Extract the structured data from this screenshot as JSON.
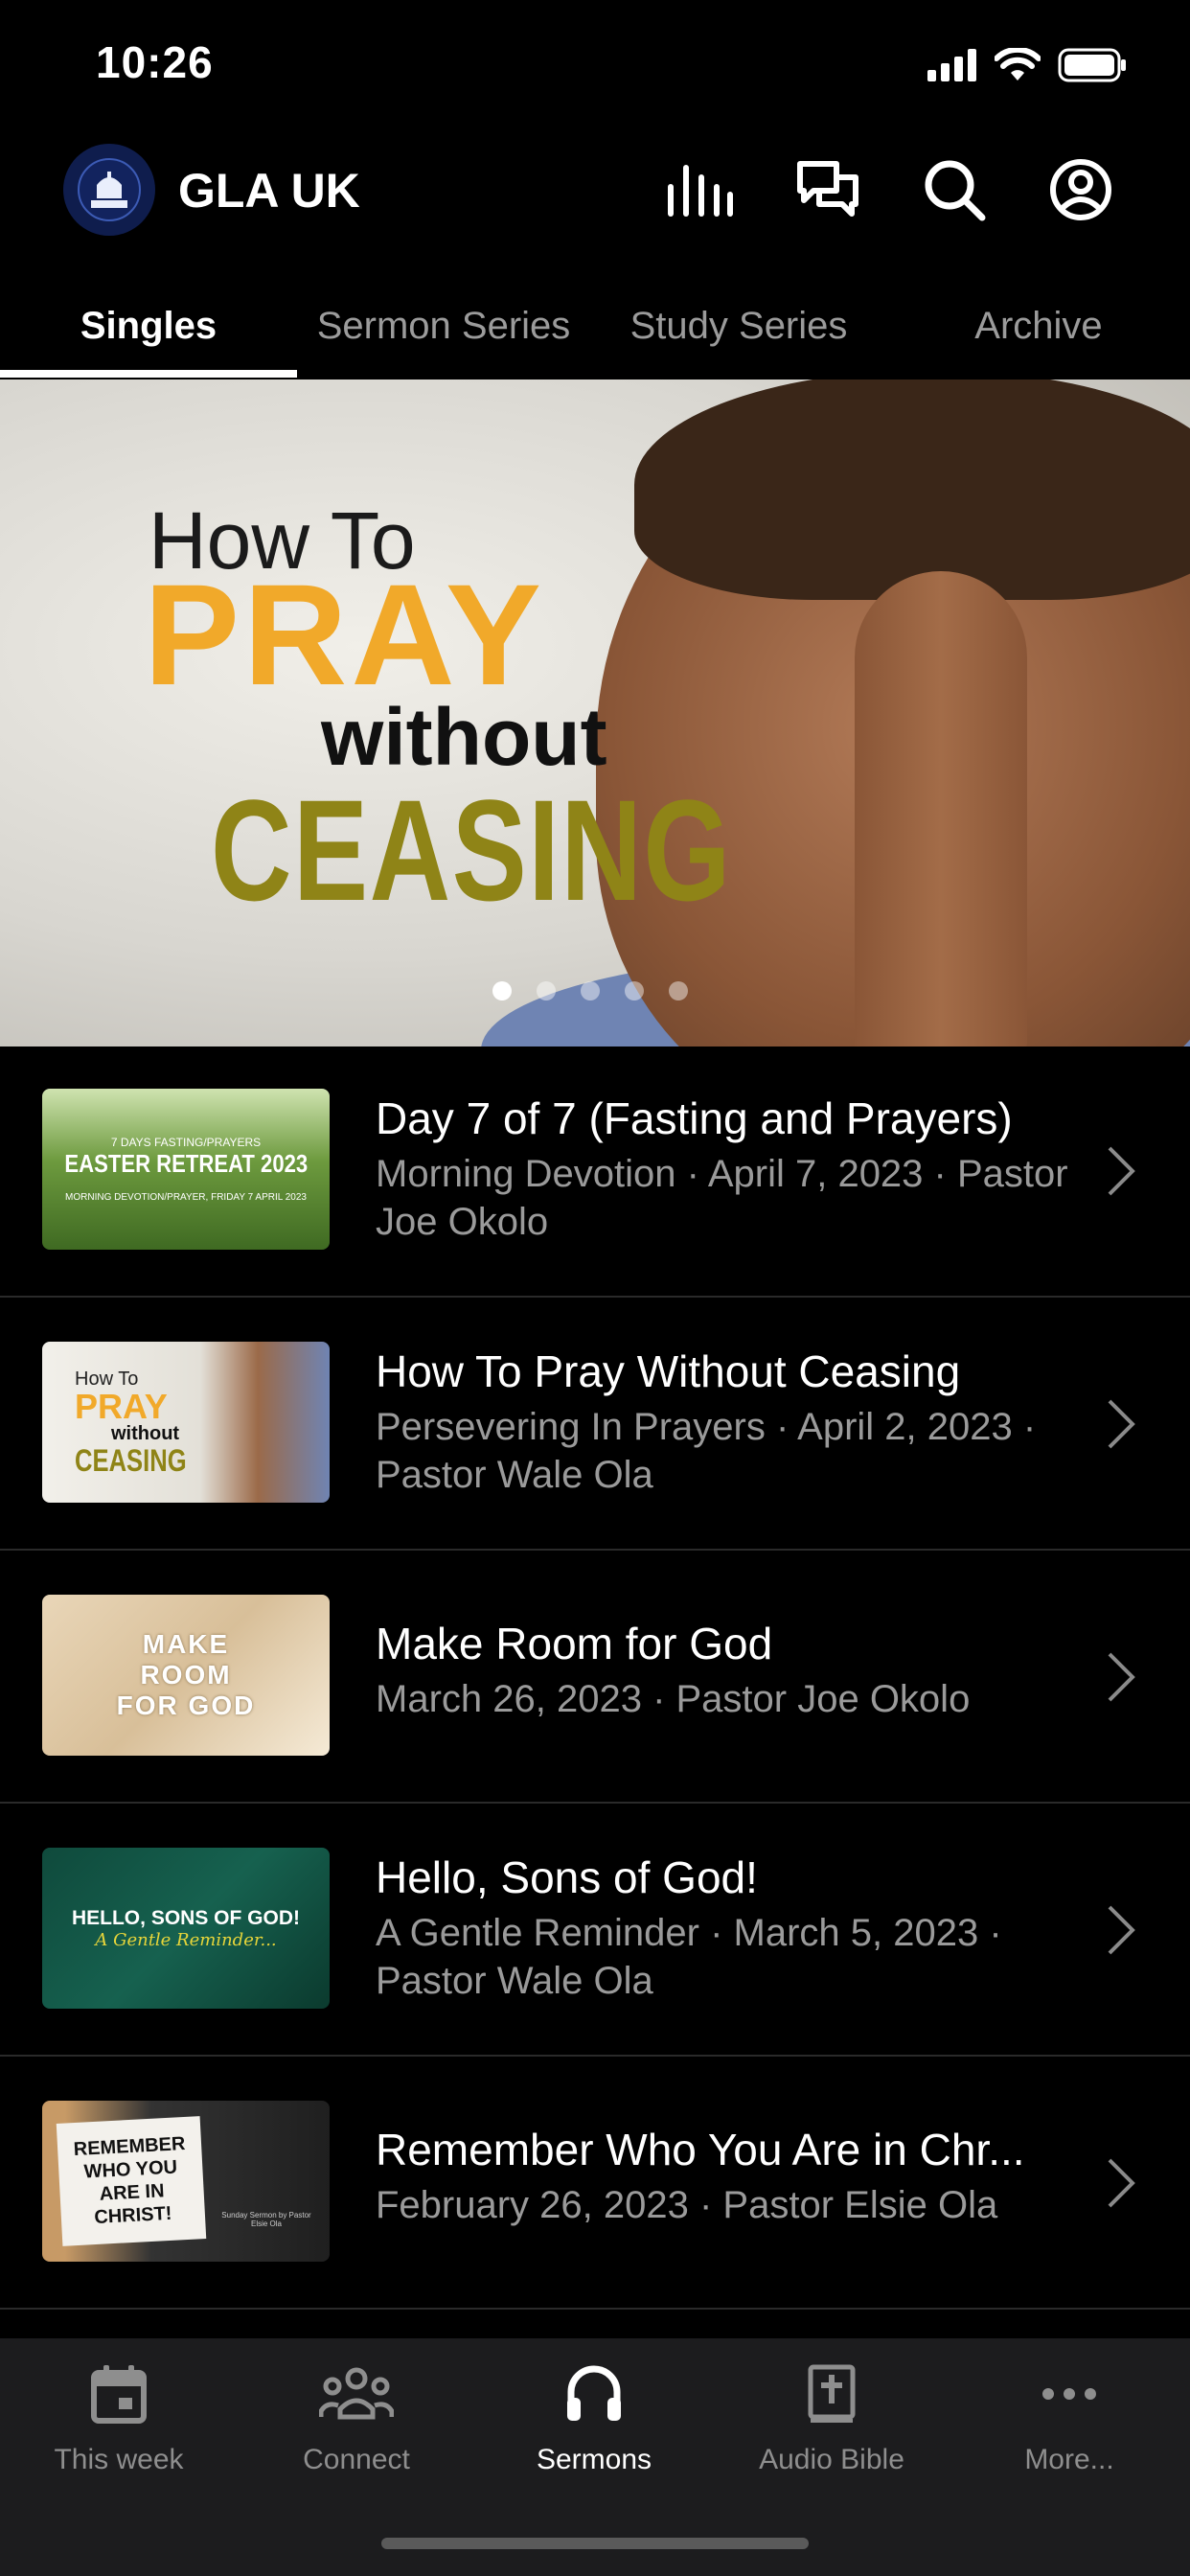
{
  "status_bar": {
    "time": "10:26"
  },
  "header": {
    "title": "GLA UK",
    "logo_text": "LIGHTHOUSE",
    "icons": [
      "equalizer-icon",
      "chat-icon",
      "search-icon",
      "account-icon"
    ]
  },
  "tabs": [
    {
      "label": "Singles",
      "active": true
    },
    {
      "label": "Sermon Series",
      "active": false
    },
    {
      "label": "Study Series",
      "active": false
    },
    {
      "label": "Archive",
      "active": false
    }
  ],
  "hero": {
    "line1": "How To",
    "line2": "PRAY",
    "line3": "without",
    "line4": "CEASING",
    "page_count": 5,
    "active_page": 1
  },
  "sermons": [
    {
      "title": "Day 7 of 7 (Fasting and Prayers)",
      "subtitle": "Morning Devotion · April 7, 2023 · Pastor Joe Okolo",
      "thumb": {
        "top": "7 DAYS FASTING/PRAYERS",
        "main": "EASTER RETREAT 2023",
        "bottom": "MORNING DEVOTION/PRAYER, FRIDAY 7 APRIL 2023"
      }
    },
    {
      "title": "How To Pray Without Ceasing",
      "subtitle": "Persevering In Prayers · April 2, 2023 · Pastor Wale Ola",
      "thumb": {
        "l1": "How To",
        "l2": "PRAY",
        "l3": "without",
        "l4": "CEASING"
      }
    },
    {
      "title": "Make Room for God",
      "subtitle": "March 26, 2023 · Pastor Joe Okolo",
      "thumb": {
        "l1": "MAKE",
        "l2": "ROOM",
        "l3": "FOR GOD"
      }
    },
    {
      "title": "Hello, Sons of God!",
      "subtitle": "A Gentle Reminder · March 5, 2023 · Pastor Wale Ola",
      "thumb": {
        "main": "HELLO, SONS OF GOD!",
        "sub": "A Gentle Reminder..."
      }
    },
    {
      "title": "Remember Who You Are in Chr...",
      "subtitle": "February 26, 2023 · Pastor Elsie Ola",
      "thumb": {
        "main": "REMEMBER WHO YOU ARE IN CHRIST!",
        "caption": "Sunday Sermon by Pastor Elsie Ola"
      }
    }
  ],
  "bottom_nav": [
    {
      "label": "This week",
      "icon": "calendar-icon",
      "active": false
    },
    {
      "label": "Connect",
      "icon": "people-icon",
      "active": false
    },
    {
      "label": "Sermons",
      "icon": "headphones-icon",
      "active": true
    },
    {
      "label": "Audio Bible",
      "icon": "bible-icon",
      "active": false
    },
    {
      "label": "More...",
      "icon": "more-icon",
      "active": false
    }
  ],
  "colors": {
    "background": "#000000",
    "tabbar": "#1c1c1e",
    "accent_pray": "#f1a92a",
    "accent_ceasing": "#8f8417"
  }
}
